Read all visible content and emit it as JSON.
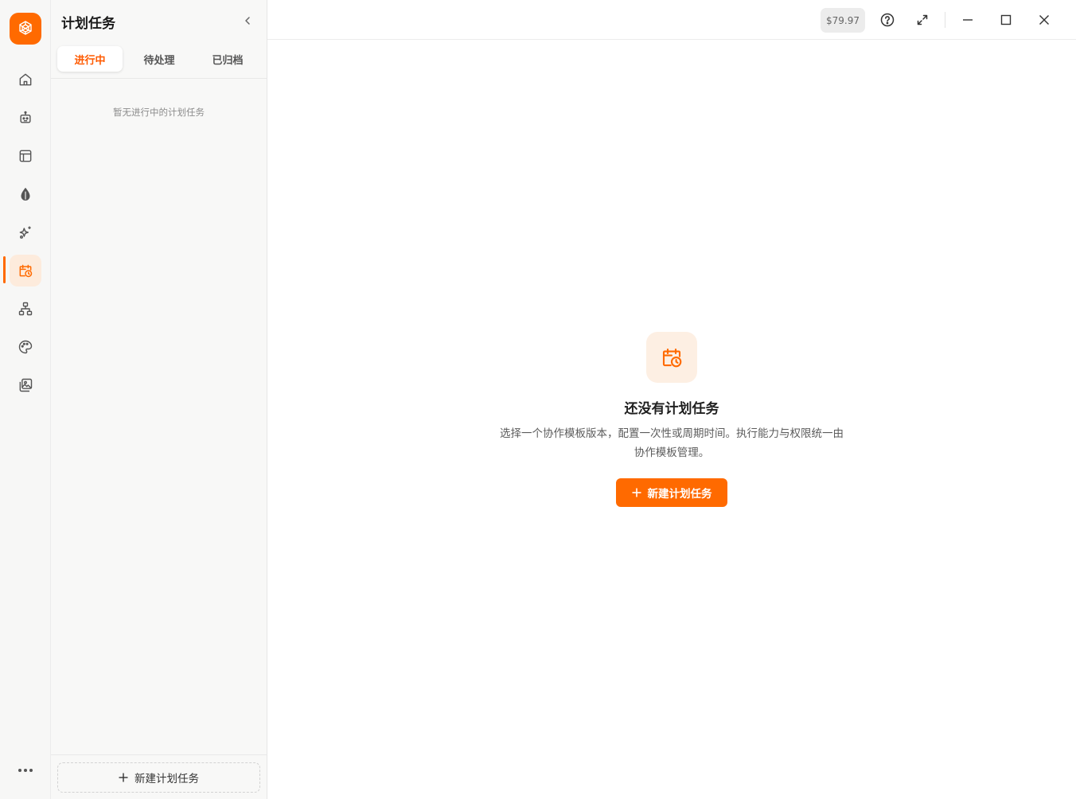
{
  "brand": {
    "accent": "#ff6a00"
  },
  "rail": {
    "items": [
      {
        "icon": "home-icon"
      },
      {
        "icon": "robot-icon"
      },
      {
        "icon": "layout-icon"
      },
      {
        "icon": "leaf-icon"
      },
      {
        "icon": "sparkles-icon"
      },
      {
        "icon": "calendar-clock-icon",
        "active": true
      },
      {
        "icon": "org-chart-icon"
      },
      {
        "icon": "palette-icon"
      },
      {
        "icon": "images-icon"
      }
    ]
  },
  "panel": {
    "title": "计划任务",
    "tabs": [
      {
        "label": "进行中",
        "active": true
      },
      {
        "label": "待处理",
        "active": false
      },
      {
        "label": "已归档",
        "active": false
      }
    ],
    "empty_text": "暂无进行中的计划任务",
    "new_button": "新建计划任务"
  },
  "topbar": {
    "balance": "$79.97"
  },
  "main": {
    "empty_title": "还没有计划任务",
    "empty_desc_line1": "选择一个协作模板版本，配置一次性或周期时间。执行能力与权限统一由",
    "empty_desc_line2": "协作模板管理。",
    "primary_button": "新建计划任务"
  }
}
